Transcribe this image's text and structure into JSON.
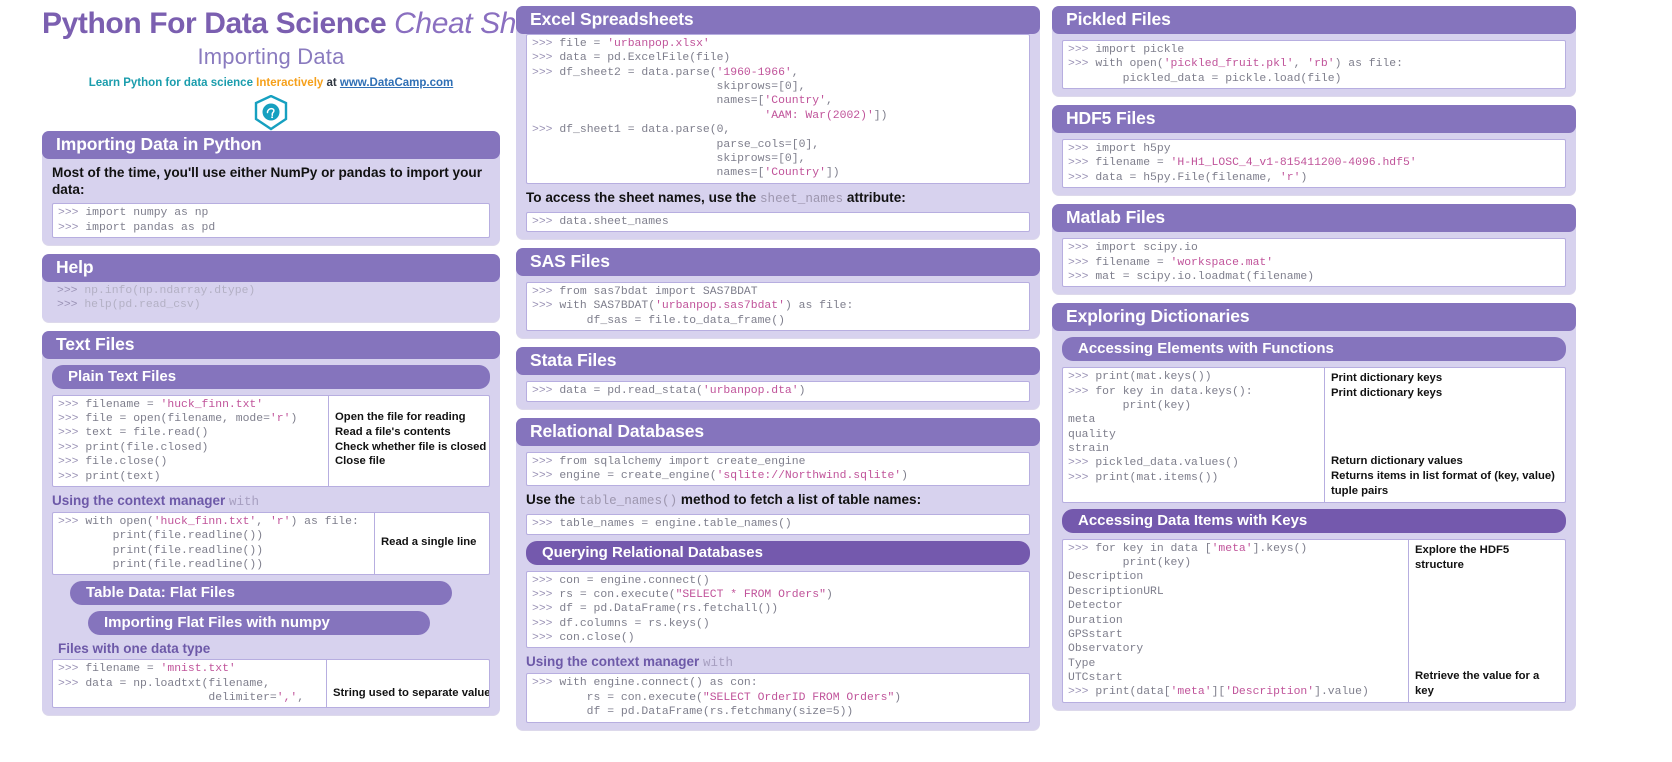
{
  "title": {
    "main_bold": "Python For Data Science ",
    "main_italic": "Cheat Sheet",
    "subtitle": "Importing Data",
    "tagline_pre": "Learn Python for data science ",
    "tagline_highlight": "Interactively",
    "tagline_at": " at ",
    "tagline_link": "www.DataCamp.com",
    "logo_name": "datacamp-logo"
  },
  "colors": {
    "header_purple": "#8574bd",
    "header_purple_deep": "#7459ad",
    "card_bg": "#d7d2ee",
    "title_purple": "#7b5fb0",
    "teal": "#1b9dad",
    "orange": "#f6a01a",
    "link_blue": "#2f6fb5",
    "string_pink": "#c0539a"
  },
  "left": {
    "importing": {
      "heading": "Importing Data in Python",
      "paragraph_parts": [
        "Most of the time, you'll use either ",
        "NumPy",
        " or ",
        "pandas",
        " to import your data:"
      ],
      "code": ">>> import numpy as np\n>>> import pandas as pd"
    },
    "help": {
      "heading": "Help",
      "code": ">>> np.info(np.ndarray.dtype)\n>>> help(pd.read_csv)"
    },
    "text_files": {
      "heading": "Text Files",
      "plain": {
        "subheading": "Plain Text Files",
        "code": ">>> filename = 'huck_finn.txt'\n>>> file = open(filename, mode='r')\n>>> text = file.read()\n>>> print(file.closed)\n>>> file.close()\n>>> print(text)",
        "descriptions": [
          "Open the file for reading",
          "Read a file's contents",
          "Check whether file is closed",
          "Close file"
        ]
      },
      "context": {
        "label_bold": "Using the context manager ",
        "label_code": "with",
        "code": ">>> with open('huck_finn.txt', 'r') as file:\n        print(file.readline())\n        print(file.readline())\n        print(file.readline())",
        "descriptions": [
          "Read a single line"
        ]
      },
      "flat": {
        "subheading": "Table Data: Flat Files",
        "numpy_subheading": "Importing Flat Files with numpy",
        "one_type_label": "Files with one data type",
        "code": ">>> filename = 'mnist.txt'\n>>> data = np.loadtxt(filename,\n                      delimiter=',',",
        "descriptions": [
          "String used to separate values"
        ]
      }
    }
  },
  "middle": {
    "excel": {
      "heading": "Excel Spreadsheets",
      "code": ">>> file = 'urbanpop.xlsx'\n>>> data = pd.ExcelFile(file)\n>>> df_sheet2 = data.parse('1960-1966',\n                           skiprows=[0],\n                           names=['Country',\n                                  'AAM: War(2002)'])\n>>> df_sheet1 = data.parse(0,\n                           parse_cols=[0],\n                           skiprows=[0],\n                           names=['Country'])",
      "note_parts": [
        "To access the sheet names, use the ",
        "sheet_names",
        " attribute:"
      ],
      "code2": ">>> data.sheet_names"
    },
    "sas": {
      "heading": "SAS Files",
      "code": ">>> from sas7bdat import SAS7BDAT\n>>> with SAS7BDAT('urbanpop.sas7bdat') as file:\n        df_sas = file.to_data_frame()"
    },
    "stata": {
      "heading": "Stata Files",
      "code": ">>> data = pd.read_stata('urbanpop.dta')"
    },
    "relational": {
      "heading": "Relational Databases",
      "code": ">>> from sqlalchemy import create_engine\n>>> engine = create_engine('sqlite://Northwind.sqlite')",
      "note_parts": [
        "Use the ",
        "table_names()",
        " method to fetch a list of table names:"
      ],
      "code2": ">>> table_names = engine.table_names()",
      "querying": {
        "subheading": "Querying Relational Databases",
        "code": ">>> con = engine.connect()\n>>> rs = con.execute(\"SELECT * FROM Orders\")\n>>> df = pd.DataFrame(rs.fetchall())\n>>> df.columns = rs.keys()\n>>> con.close()",
        "context_label_bold": "Using the context manager ",
        "context_label_code": "with",
        "code2": ">>> with engine.connect() as con:\n        rs = con.execute(\"SELECT OrderID FROM Orders\")\n        df = pd.DataFrame(rs.fetchmany(size=5))"
      }
    }
  },
  "right": {
    "pickled": {
      "heading": "Pickled Files",
      "code": ">>> import pickle\n>>> with open('pickled_fruit.pkl', 'rb') as file:\n        pickled_data = pickle.load(file)"
    },
    "hdf5": {
      "heading": "HDF5 Files",
      "code": ">>> import h5py\n>>> filename = 'H-H1_LOSC_4_v1-815411200-4096.hdf5'\n>>> data = h5py.File(filename, 'r')"
    },
    "matlab": {
      "heading": "Matlab Files",
      "code": ">>> import scipy.io\n>>> filename = 'workspace.mat'\n>>> mat = scipy.io.loadmat(filename)"
    },
    "dictionaries": {
      "heading": "Exploring Dictionaries",
      "functions": {
        "subheading": "Accessing Elements with Functions",
        "code": ">>> print(mat.keys())\n>>> for key in data.keys():\n        print(key)\nmeta\nquality\nstrain\n>>> pickled_data.values()\n>>> print(mat.items())",
        "descriptions": [
          "Print dictionary keys",
          "Print dictionary keys",
          "",
          "",
          "",
          "",
          "Return dictionary values",
          "Returns items in list format of (key, value) tuple pairs"
        ]
      },
      "keys": {
        "subheading": "Accessing Data Items with Keys",
        "code": ">>> for key in data ['meta'].keys()\n        print(key)\nDescription\nDescriptionURL\nDetector\nDuration\nGPSstart\nObservatory\nType\nUTCstart\n>>> print(data['meta']['Description'].value)",
        "desc_top": "Explore the HDF5 structure",
        "desc_bottom": "Retrieve the value for a key"
      }
    }
  }
}
